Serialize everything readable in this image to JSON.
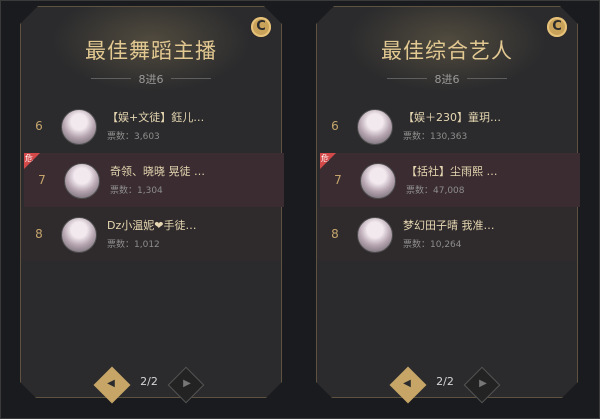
{
  "pager": {
    "text": "2/2"
  },
  "cards": [
    {
      "title": "最佳舞蹈主播",
      "subtitle": "8进6",
      "rows": [
        {
          "rank": "6",
          "name": "【娱+文徒】鈺儿…",
          "votes": "票数：3,603",
          "danger": false
        },
        {
          "rank": "7",
          "name": "奇领、晓晓 晃徒 …",
          "votes": "票数：1,304",
          "danger": true,
          "danger_label": "危"
        },
        {
          "rank": "8",
          "name": "Dz小温妮❤手徒…",
          "votes": "票数：1,012",
          "danger": false
        }
      ]
    },
    {
      "title": "最佳综合艺人",
      "subtitle": "8进6",
      "rows": [
        {
          "rank": "6",
          "name": "【娱＋230】童玥…",
          "votes": "票数：130,363",
          "danger": false
        },
        {
          "rank": "7",
          "name": "【括社】尘雨熙 …",
          "votes": "票数：47,008",
          "danger": true,
          "danger_label": "危"
        },
        {
          "rank": "8",
          "name": "梦幻田子晴 我准…",
          "votes": "票数：10,264",
          "danger": false
        }
      ]
    }
  ]
}
